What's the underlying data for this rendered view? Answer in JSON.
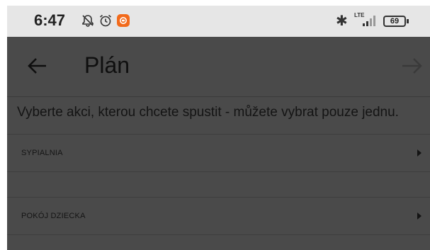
{
  "status_bar": {
    "time": "6:47",
    "network": "LTE",
    "battery": "69"
  },
  "header": {
    "title": "Plán"
  },
  "instruction": "Vyberte akci, kterou chcete spustit - můžete vybrat pouze jednu.",
  "items": [
    {
      "label": "SYPIALNIA"
    },
    {
      "label": "POKÓJ DZIECKA"
    }
  ],
  "colors": {
    "overlay": "#4a4a4a",
    "status_bar": "#e6e6e6",
    "text": "#141414"
  },
  "icons": [
    "notifications-off-icon",
    "alarm-icon",
    "app-notification-icon",
    "bluetooth-icon",
    "signal-icon",
    "battery-icon",
    "back-arrow-icon",
    "forward-arrow-icon",
    "chevron-right-icon"
  ]
}
